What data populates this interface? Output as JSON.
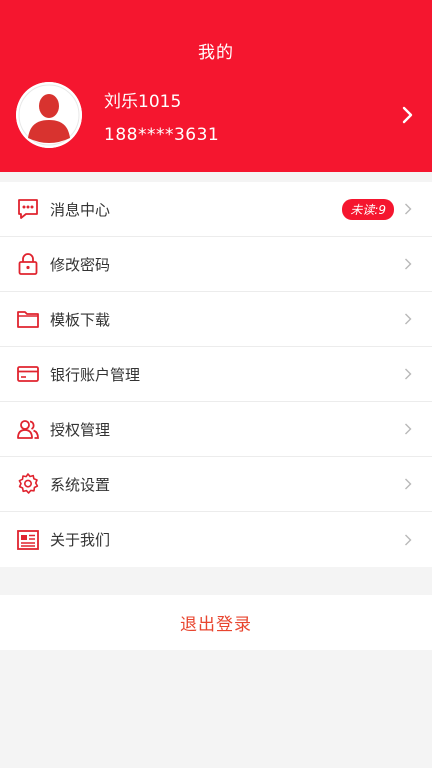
{
  "header": {
    "title": "我的",
    "user_name": "刘乐1015",
    "phone": "188****3631"
  },
  "menu": [
    {
      "label": "消息中心",
      "icon": "message-icon",
      "badge": "未读:9"
    },
    {
      "label": "修改密码",
      "icon": "lock-icon"
    },
    {
      "label": "模板下载",
      "icon": "folder-icon"
    },
    {
      "label": "银行账户管理",
      "icon": "card-icon"
    },
    {
      "label": "授权管理",
      "icon": "users-icon"
    },
    {
      "label": "系统设置",
      "icon": "gear-icon"
    },
    {
      "label": "关于我们",
      "icon": "newspaper-icon"
    }
  ],
  "logout_label": "退出登录",
  "colors": {
    "brand": "#f5162f",
    "logout": "#e8452f"
  }
}
